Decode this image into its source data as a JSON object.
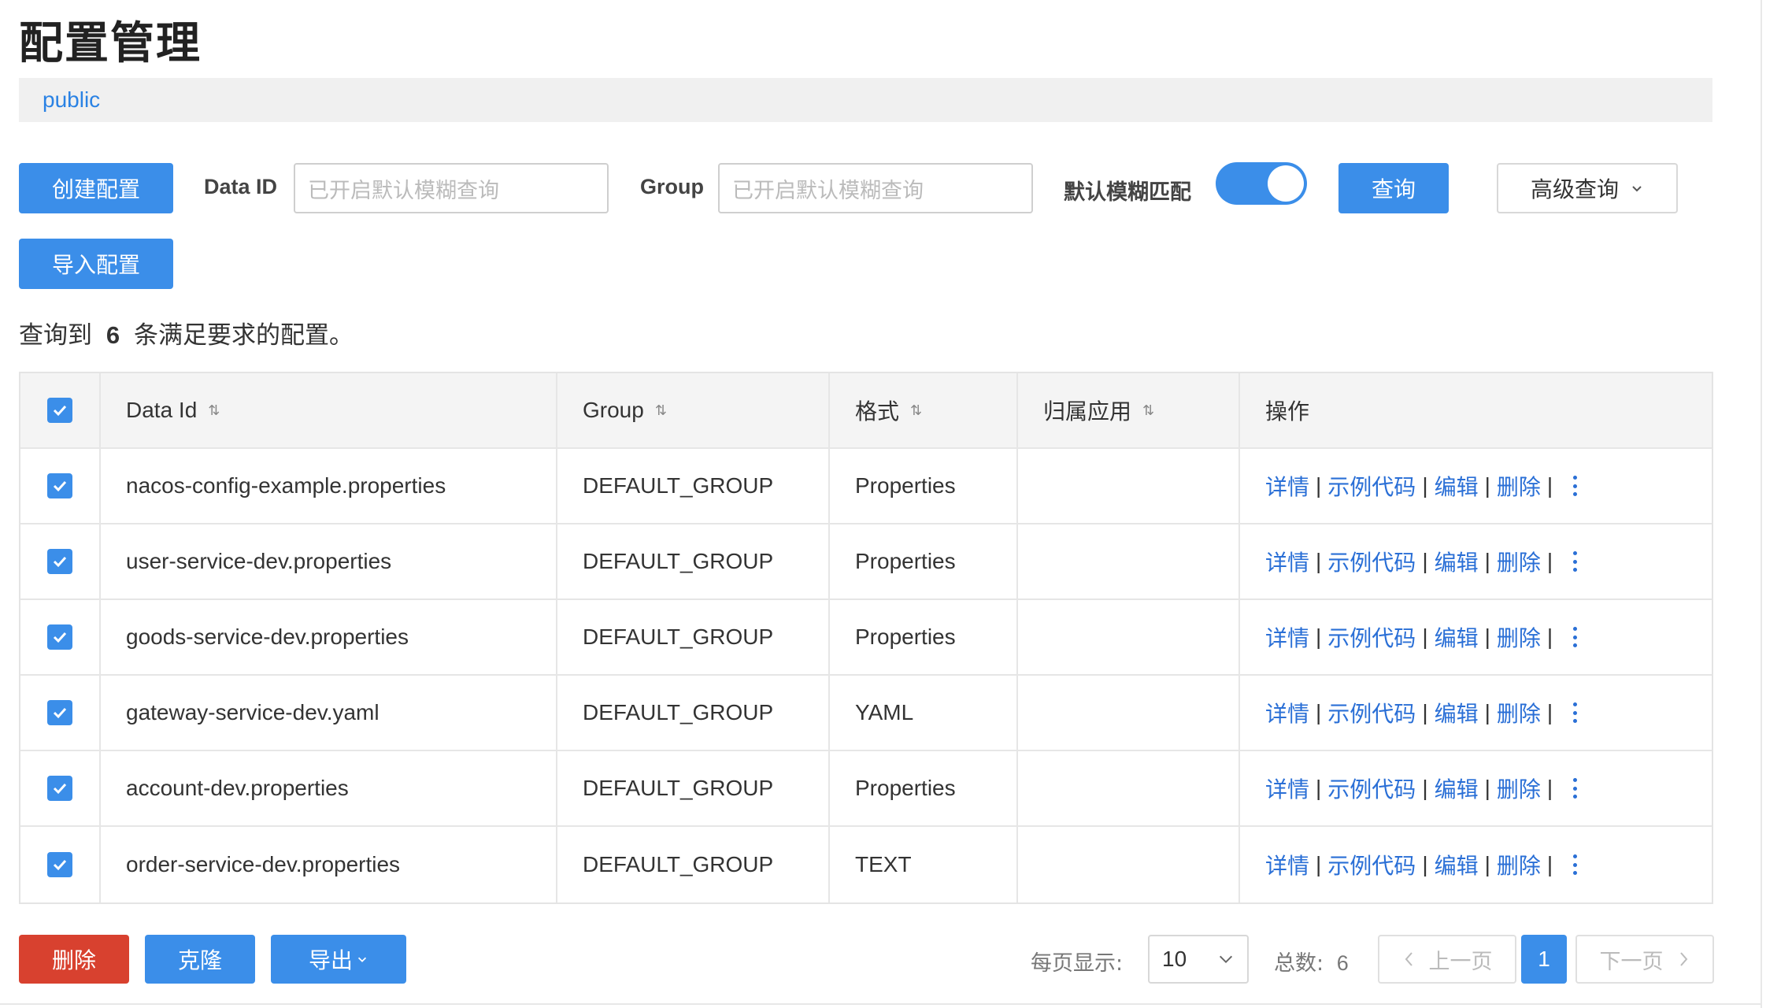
{
  "page": {
    "title": "配置管理"
  },
  "namespace": {
    "label": "public"
  },
  "toolbar": {
    "create_label": "创建配置",
    "import_label": "导入配置",
    "data_id_label": "Data ID",
    "data_id_placeholder": "已开启默认模糊查询",
    "group_label": "Group",
    "group_placeholder": "已开启默认模糊查询",
    "fuzzy_label": "默认模糊匹配",
    "fuzzy_enabled": true,
    "query_label": "查询",
    "advanced_label": "高级查询"
  },
  "summary": {
    "prefix": "查询到",
    "count": "6",
    "suffix": "条满足要求的配置。"
  },
  "table": {
    "columns": [
      "Data Id",
      "Group",
      "格式",
      "归属应用",
      "操作"
    ],
    "rows": [
      {
        "data_id": "nacos-config-example.properties",
        "group": "DEFAULT_GROUP",
        "format": "Properties",
        "app": ""
      },
      {
        "data_id": "user-service-dev.properties",
        "group": "DEFAULT_GROUP",
        "format": "Properties",
        "app": ""
      },
      {
        "data_id": "goods-service-dev.properties",
        "group": "DEFAULT_GROUP",
        "format": "Properties",
        "app": ""
      },
      {
        "data_id": "gateway-service-dev.yaml",
        "group": "DEFAULT_GROUP",
        "format": "YAML",
        "app": ""
      },
      {
        "data_id": "account-dev.properties",
        "group": "DEFAULT_GROUP",
        "format": "Properties",
        "app": ""
      },
      {
        "data_id": "order-service-dev.properties",
        "group": "DEFAULT_GROUP",
        "format": "TEXT",
        "app": ""
      }
    ],
    "actions": {
      "detail": "详情",
      "sample": "示例代码",
      "edit": "编辑",
      "delete": "删除",
      "sep": "|"
    }
  },
  "footer": {
    "delete_label": "删除",
    "clone_label": "克隆",
    "export_label": "导出",
    "page_size_label": "每页显示:",
    "page_size": "10",
    "total_label": "总数:",
    "total": "6",
    "prev_label": "上一页",
    "current_page": "1",
    "next_label": "下一页"
  },
  "colors": {
    "primary": "#3b8ee9",
    "danger": "#d8412f",
    "link": "#2a6fd6"
  },
  "icons": [
    "sort-icon",
    "checkbox-checked-icon",
    "chevron-down-icon",
    "more-vertical-icon",
    "chevron-left-icon",
    "chevron-right-icon"
  ]
}
